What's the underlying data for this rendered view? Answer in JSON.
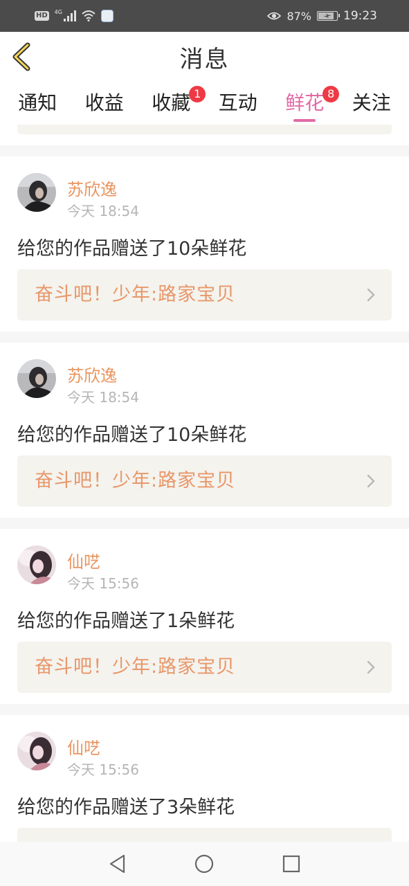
{
  "status_bar": {
    "hd": "HD",
    "network": "4G",
    "battery": "87%",
    "battery_level": 0.87,
    "time": "19:23"
  },
  "header": {
    "title": "消息"
  },
  "tabs": [
    {
      "label": "通知",
      "badge": ""
    },
    {
      "label": "收益",
      "badge": ""
    },
    {
      "label": "收藏",
      "badge": "1"
    },
    {
      "label": "互动",
      "badge": ""
    },
    {
      "label": "鲜花",
      "badge": "8",
      "active": true
    },
    {
      "label": "关注",
      "badge": ""
    }
  ],
  "colors": {
    "accent": "#e26aa6",
    "name": "#e89560",
    "badge": "#ee3a44"
  },
  "messages": [
    {
      "name": "苏欣逸",
      "time": "今天 18:54",
      "text": "给您的作品赠送了10朵鲜花",
      "work": "奋斗吧！少年:路家宝贝"
    },
    {
      "name": "苏欣逸",
      "time": "今天 18:54",
      "text": "给您的作品赠送了10朵鲜花",
      "work": "奋斗吧！少年:路家宝贝"
    },
    {
      "name": "仙呓",
      "time": "今天 15:56",
      "text": "给您的作品赠送了1朵鲜花",
      "work": "奋斗吧！少年:路家宝贝"
    },
    {
      "name": "仙呓",
      "time": "今天 15:56",
      "text": "给您的作品赠送了3朵鲜花",
      "work": ""
    }
  ]
}
